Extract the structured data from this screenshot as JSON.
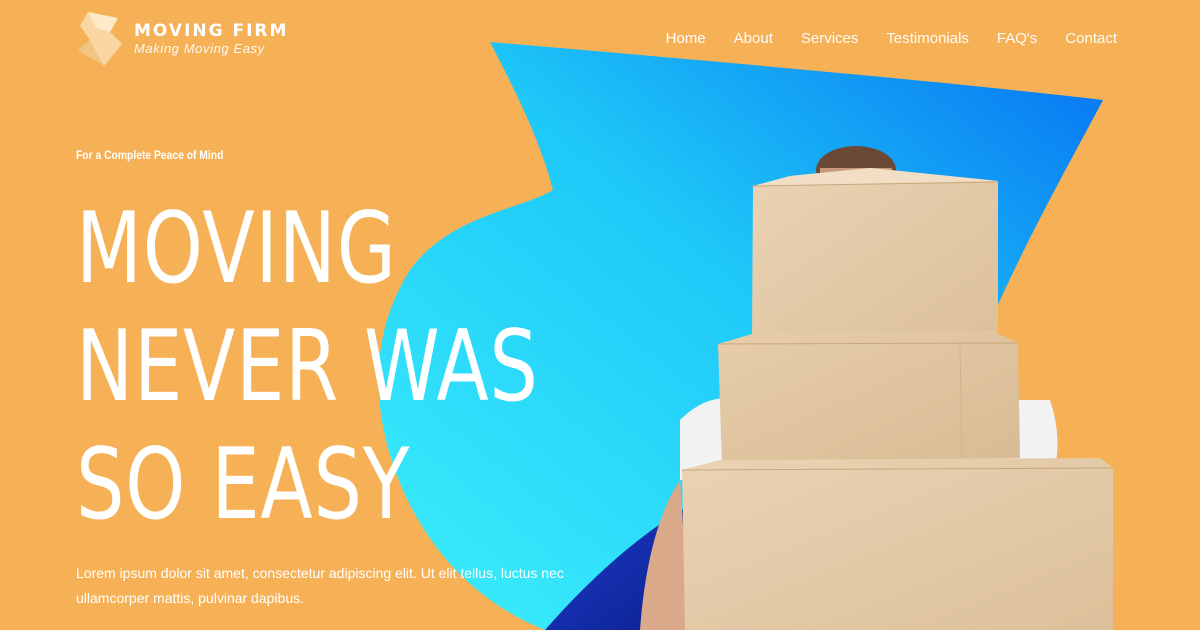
{
  "brand": {
    "name": "MOVING FIRM",
    "tagline": "Making Moving Easy"
  },
  "nav": {
    "items": [
      {
        "label": "Home",
        "active": true
      },
      {
        "label": "About",
        "active": false
      },
      {
        "label": "Services",
        "active": false
      },
      {
        "label": "Testimonials",
        "active": false
      },
      {
        "label": "FAQ's",
        "active": false
      },
      {
        "label": "Contact",
        "active": false
      }
    ]
  },
  "hero": {
    "eyebrow": "For a Complete Peace of Mind",
    "headline_lines": [
      "MOVING",
      "NEVER WAS",
      "SO EASY"
    ],
    "description": "Lorem ipsum dolor sit amet, consectetur adipiscing elit. Ut elit tellus, luctus nec ullamcorper mattis, pulvinar dapibus."
  },
  "colors": {
    "background": "#f6b157",
    "accent_blue": "#1fd3f7",
    "accent_blue_dark": "#0a7cf0",
    "box": "#e3c7a3"
  },
  "icons": {
    "logo": "folded-ribbon-logo"
  }
}
